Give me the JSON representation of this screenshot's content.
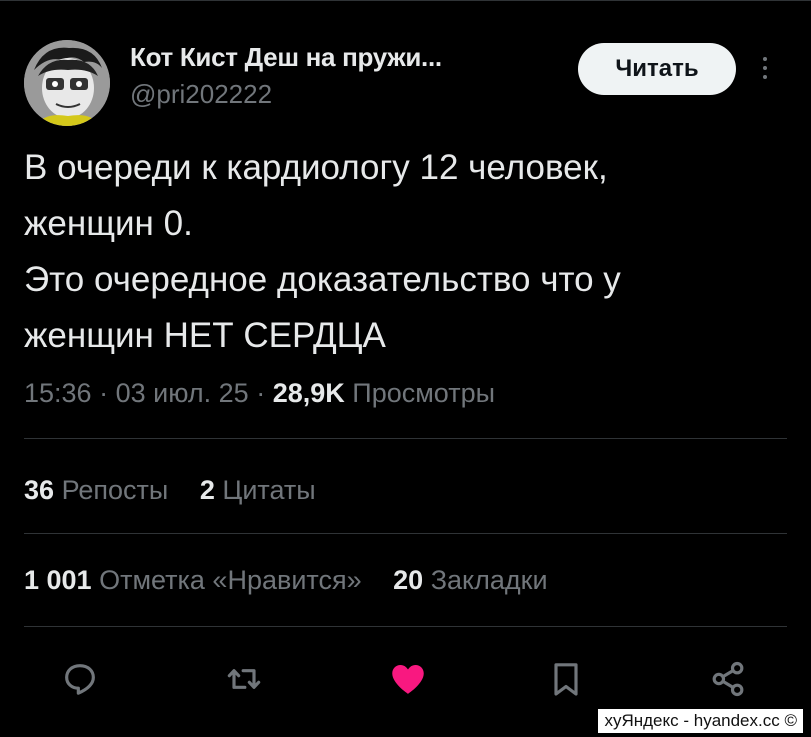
{
  "author": {
    "name": "Кот Кист Деш на пружи...",
    "handle": "@pri202222"
  },
  "follow_button": {
    "label": "Читать"
  },
  "tweet": {
    "lines": [
      "В очереди к кардиологу 12 человек,",
      "женщин 0.",
      "Это очередное доказательство что у",
      "женщин НЕТ СЕРДЦА"
    ]
  },
  "meta": {
    "time": "15:36",
    "separator": "·",
    "date": "03 июл. 25",
    "views_count": "28,9K",
    "views_label": "Просмотры"
  },
  "stats": {
    "reposts_count": "36",
    "reposts_label": "Репосты",
    "quotes_count": "2",
    "quotes_label": "Цитаты",
    "likes_count": "1 001",
    "likes_label": "Отметка «Нравится»",
    "bookmarks_count": "20",
    "bookmarks_label": "Закладки"
  },
  "actions": {
    "icons": [
      "reply-icon",
      "repost-icon",
      "like-icon",
      "bookmark-icon",
      "share-icon"
    ],
    "like_color": "#f91880",
    "icon_color": "#71767b"
  },
  "watermark": "хуЯндекс - hyandex.cc ©",
  "colors": {
    "background": "#000000",
    "text": "#e7e9ea",
    "secondary": "#71767b",
    "divider": "#2f3336",
    "button_bg": "#eff3f4"
  }
}
